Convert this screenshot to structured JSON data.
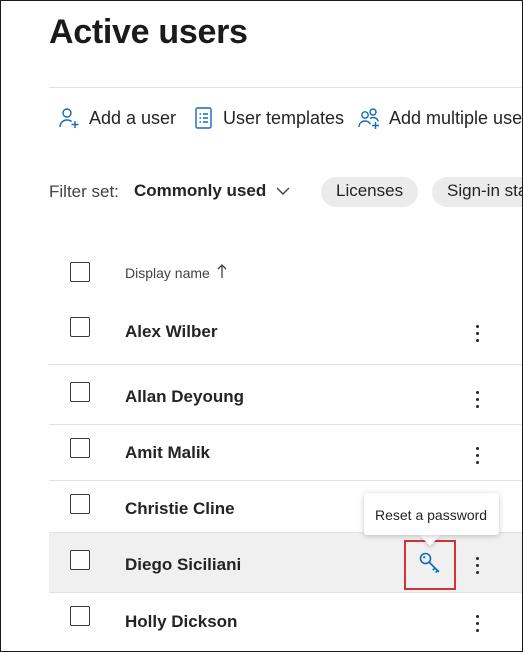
{
  "page": {
    "title": "Active users"
  },
  "toolbar": {
    "add_user_label": "Add a user",
    "user_templates_label": "User templates",
    "add_multiple_users_label": "Add multiple users"
  },
  "filter": {
    "label": "Filter set:",
    "selected_set": "Commonly used",
    "pills": [
      "Licenses",
      "Sign-in status"
    ]
  },
  "table": {
    "columns": {
      "display_name": "Display name",
      "sort": "ascending"
    },
    "rows": [
      {
        "name": "Alex Wilber",
        "selected": false
      },
      {
        "name": "Allan Deyoung",
        "selected": false
      },
      {
        "name": "Amit Malik",
        "selected": false
      },
      {
        "name": "Christie Cline",
        "selected": false
      },
      {
        "name": "Diego Siciliani",
        "selected": false,
        "hovered": true
      },
      {
        "name": "Holly Dickson",
        "selected": false
      }
    ]
  },
  "tooltip": {
    "text": "Reset a password"
  },
  "icons": {
    "add_user": "person-add-icon",
    "user_templates": "document-list-icon",
    "add_multiple_users": "people-add-icon",
    "filter_dropdown": "chevron-down-icon",
    "sort": "arrow-up-icon",
    "reset_password": "key-icon",
    "row_actions": "more-vertical-icon"
  },
  "colors": {
    "accent_blue": "#0f6cbd",
    "highlight_red": "#d13438",
    "hover_row": "#f0f0f0",
    "pill_bg": "#ebebeb"
  }
}
